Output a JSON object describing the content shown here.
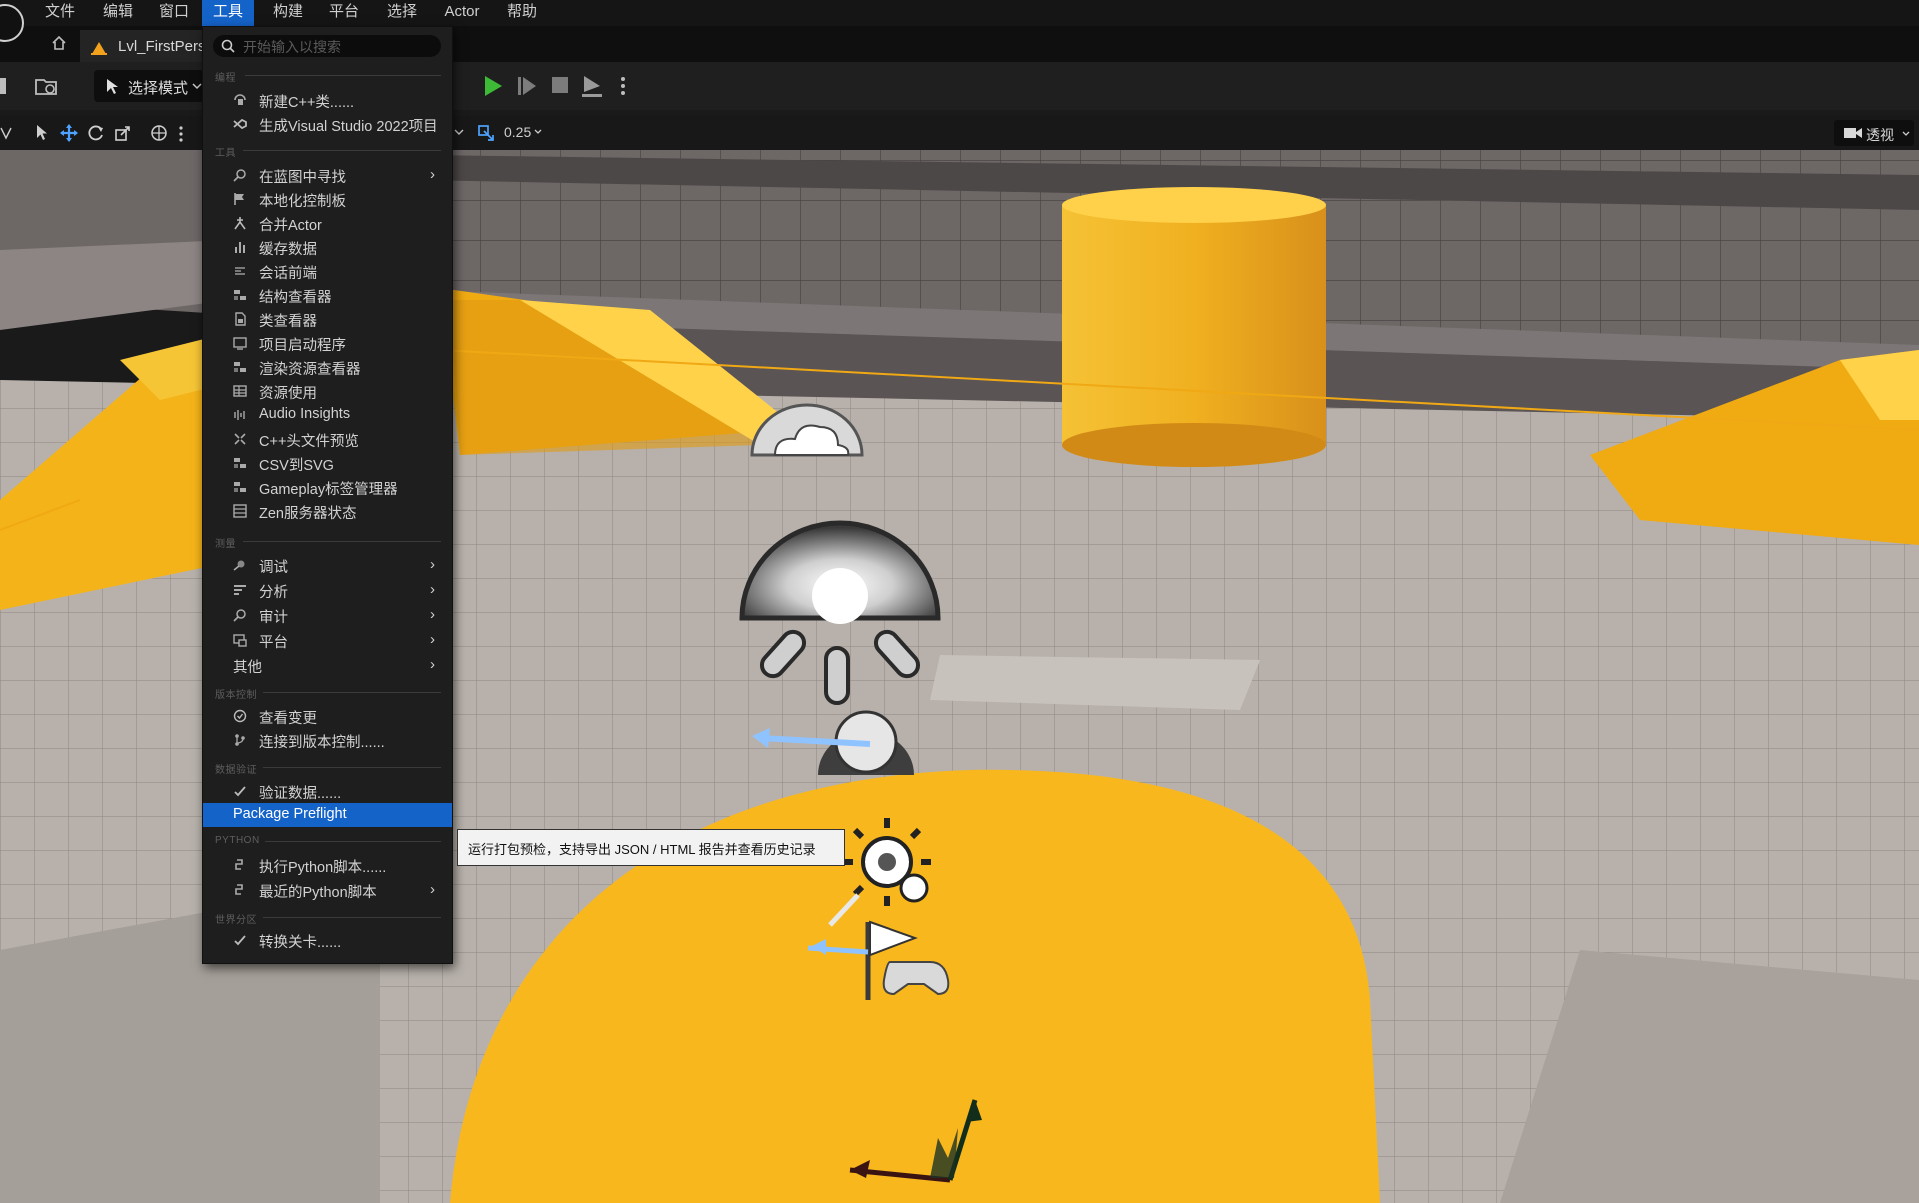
{
  "menubar": {
    "items": [
      "文件",
      "编辑",
      "窗口",
      "工具",
      "构建",
      "平台",
      "选择",
      "Actor",
      "帮助"
    ],
    "active": "工具"
  },
  "tabs": {
    "level_tab": "Lvl_FirstPerson"
  },
  "toolbar": {
    "mode_label": "选择模式",
    "snap_value": "0.25",
    "perspective_label": "透视"
  },
  "dropdown": {
    "search_placeholder": "开始输入以搜索",
    "sections": {
      "programming": "编程",
      "tools": "工具",
      "instrumentation": "测量",
      "source_control": "版本控制",
      "data_validation": "数据验证",
      "python": "PYTHON",
      "world_partition": "世界分区"
    },
    "items": {
      "new_cpp_class": "新建C++类......",
      "gen_vs_project": "生成Visual Studio 2022项目",
      "find_in_blueprints": "在蓝图中寻找",
      "localization_dashboard": "本地化控制板",
      "merge_actors": "合并Actor",
      "cache_data": "缓存数据",
      "session_frontend": "会话前端",
      "struct_viewer": "结构查看器",
      "class_viewer": "类查看器",
      "project_launcher": "项目启动程序",
      "render_resource_viewer": "渲染资源查看器",
      "resource_usage": "资源使用",
      "audio_insights": "Audio Insights",
      "cpp_header_preview": "C++头文件预览",
      "csv_to_svg": "CSV到SVG",
      "gameplay_tags_manager": "Gameplay标签管理器",
      "zen_server_status": "Zen服务器状态",
      "debug": "调试",
      "profile": "分析",
      "audit": "审计",
      "platform": "平台",
      "misc": "其他",
      "view_changes": "查看变更",
      "connect_source_control": "连接到版本控制......",
      "validate_data": "验证数据......",
      "package_preflight": "Package Preflight",
      "execute_python": "执行Python脚本......",
      "recent_python": "最近的Python脚本",
      "convert_level": "转换关卡......"
    },
    "highlighted": "Package Preflight"
  },
  "tooltip": {
    "text": "运行打包预检，支持导出 JSON / HTML 报告并查看历史记录"
  },
  "colors": {
    "accent": "#1463c9",
    "play_green": "#3dbb36",
    "floor_orange": "#f6b21b",
    "menu_bg": "#1e1e1e"
  }
}
